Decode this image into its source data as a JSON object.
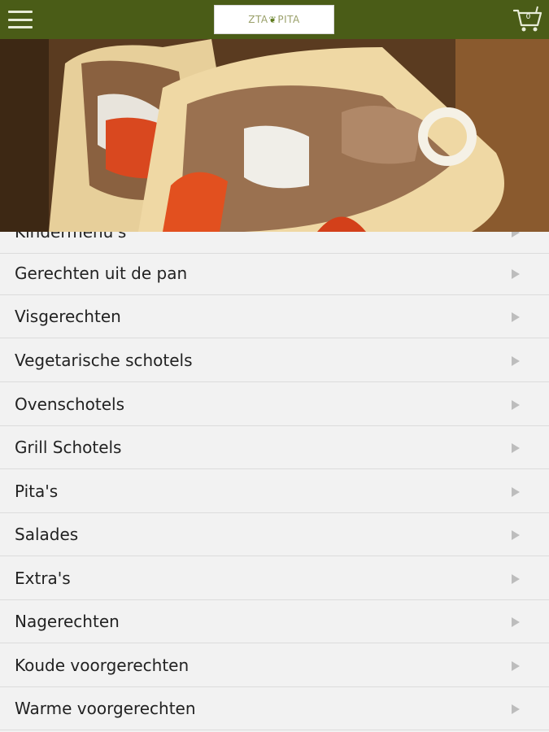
{
  "header": {
    "menu_icon": "hamburger-menu-icon",
    "logo_text_left": "ZTA",
    "logo_text_right": "PITA",
    "cart_icon": "shopping-cart-icon",
    "cart_count": "0",
    "bar_color": "#4a5c17"
  },
  "hero": {
    "description_icon": "gyros-pita-photo"
  },
  "menu": {
    "items": [
      {
        "label": "Kindermenu's"
      },
      {
        "label": "Gerechten uit de pan"
      },
      {
        "label": "Visgerechten"
      },
      {
        "label": "Vegetarische schotels"
      },
      {
        "label": "Ovenschotels"
      },
      {
        "label": "Grill Schotels"
      },
      {
        "label": "Pita's"
      },
      {
        "label": "Salades"
      },
      {
        "label": "Extra's"
      },
      {
        "label": "Nagerechten"
      },
      {
        "label": "Koude voorgerechten"
      },
      {
        "label": "Warme voorgerechten"
      }
    ]
  }
}
